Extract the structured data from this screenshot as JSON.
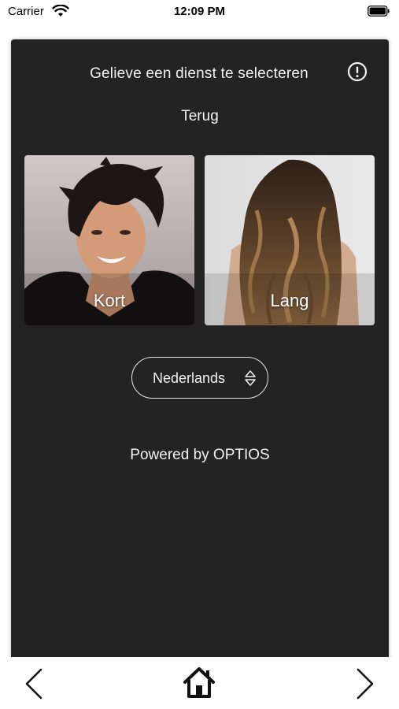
{
  "status_bar": {
    "carrier": "Carrier",
    "time": "12:09 PM"
  },
  "card": {
    "title": "Gelieve een dienst te selecteren",
    "back_label": "Terug",
    "services": [
      {
        "label": "Kort"
      },
      {
        "label": "Lang"
      }
    ],
    "language": {
      "selected": "Nederlands"
    },
    "footer": "Powered by OPTIOS"
  },
  "icons": {
    "info": "info-circle-icon",
    "select_arrows": "up-down-chevron-icon",
    "nav_back": "chevron-left-icon",
    "nav_home": "home-icon",
    "nav_forward": "chevron-right-icon"
  },
  "colors": {
    "card_background": "#232323",
    "text": "#f2f2f2"
  }
}
